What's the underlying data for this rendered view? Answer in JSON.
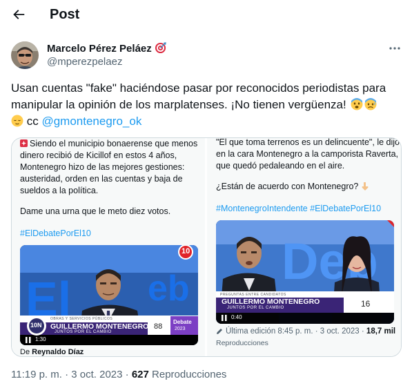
{
  "header": {
    "title": "Post"
  },
  "author": {
    "name": "Marcelo Pérez Peláez",
    "handle": "@mperezpelaez"
  },
  "tweet": {
    "text": "Usan cuentas \"fake\" haciéndose pasar por reconocidos periodistas para manipular la opinión de los marplatenses. ¡No tienen vergüenza!",
    "cc_label": "cc",
    "mention": "@gmontenegro_ok"
  },
  "left_post": {
    "line1": "Siendo el municipio bonaerense que menos",
    "line2": "dinero recibió de Kicillof en estos 4 años,",
    "line3": "Montenegro hizo de las mejores gestiones:",
    "line4": "austeridad, orden en las cuentas y baja de",
    "line5": "sueldos a la política.",
    "line6": "Dame una urna que le meto diez votos.",
    "hashtag": "#ElDebatePorEl10",
    "video": {
      "badge": "10",
      "category": "OBRAS Y SERVICIOS PÚBLICOS",
      "name": "GUILLERMO MONTENEGRO",
      "party": "JUNTOS POR EL CAMBIO",
      "number": "88",
      "debate": "Debate",
      "year": "2023",
      "channel": "10N",
      "time": "1:30"
    },
    "byline_prefix": "De",
    "byline_name": "Reynaldo Díaz"
  },
  "right_post": {
    "line1": "\"El que toma terrenos es un delincuente\", le dijo",
    "line2": "en la cara Montenegro a la camporista Raverta,",
    "line3": "que quedó pedaleando en el aire.",
    "line4": "¿Están de acuerdo con Montenegro?",
    "hashtags": "#MontenegroIntendente #ElDebatePorEl10",
    "video": {
      "category": "PREGUNTAS ENTRE CANDIDATOS",
      "name": "GUILLERMO MONTENEGRO",
      "party": "JUNTOS POR EL CAMBIO",
      "number": "16",
      "time": "0:40"
    },
    "edit_info": "Última edición 8:45 p. m. · 3 oct. 2023 ·",
    "views_count": "18,7 mil",
    "views_label": "Reproducciones"
  },
  "footer": {
    "time": "11:19 p. m. · 3 oct. 2023 ·",
    "views_count": "627",
    "views_label": "Reproducciones"
  },
  "icons": [
    "back-arrow-icon",
    "target-icon",
    "more-icon",
    "anxious-face-icon",
    "sweat-face-icon",
    "relieved-face-icon",
    "point-down-icon",
    "pencil-icon",
    "pause-icon"
  ],
  "colors": {
    "accent": "#1d9bf0",
    "text": "#0f1419",
    "muted": "#536471",
    "tv_blue": "#2a6fd6",
    "tv_purple": "#5b2a86"
  }
}
